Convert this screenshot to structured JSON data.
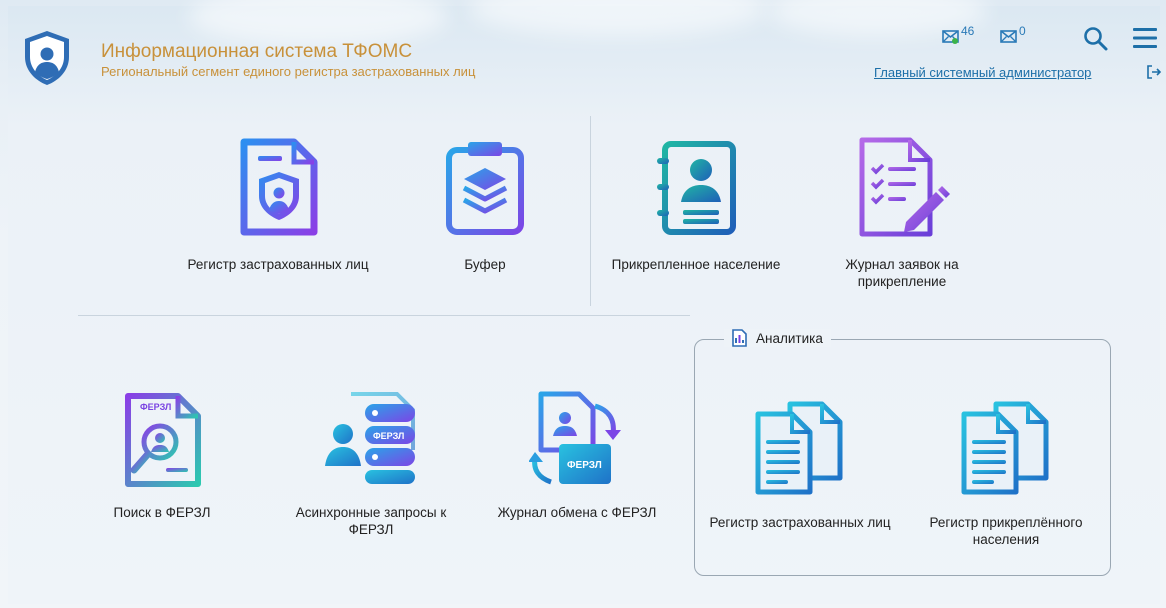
{
  "header": {
    "title": "Информационная система ТФОМС",
    "subtitle": "Региональный сегмент единого регистра застрахованных лиц",
    "inbox_count": "46",
    "outbox_count": "0",
    "user_name": "Главный системный администратор"
  },
  "icons": {
    "logo": "shield-person-icon",
    "inbox": "mail-in-icon",
    "outbox": "mail-out-icon",
    "search": "search-icon",
    "menu": "hamburger-menu-icon",
    "logout": "logout-icon"
  },
  "tiles_top": [
    {
      "label": "Регистр застрахованных лиц",
      "icon": "insured-registry-icon"
    },
    {
      "label": "Буфер",
      "icon": "buffer-icon"
    },
    {
      "label": "Прикрепленное население",
      "icon": "attached-population-icon"
    },
    {
      "label": "Журнал заявок на прикрепление",
      "icon": "attachment-requests-journal-icon"
    }
  ],
  "tiles_bottom": [
    {
      "label": "Поиск в ФЕРЗЛ",
      "icon": "ferzl-search-icon",
      "icon_text": "ФЕРЗЛ"
    },
    {
      "label": "Асинхронные запросы к ФЕРЗЛ",
      "icon": "async-requests-icon",
      "icon_text": "ФЕРЗЛ"
    },
    {
      "label": "Журнал обмена с ФЕРЗЛ",
      "icon": "exchange-journal-icon",
      "icon_text": "ФЕРЗЛ"
    }
  ],
  "analytics": {
    "legend": "Аналитика",
    "items": [
      {
        "label": "Регистр застрахованных лиц",
        "icon": "report-documents-icon"
      },
      {
        "label": "Регистр прикреплённого населения",
        "icon": "report-documents-icon"
      }
    ]
  },
  "colors": {
    "title": "#c8913a",
    "link": "#1d6fa8",
    "purple": "#7b3fe4",
    "blue": "#2f86d6",
    "teal": "#1a9aa8"
  }
}
